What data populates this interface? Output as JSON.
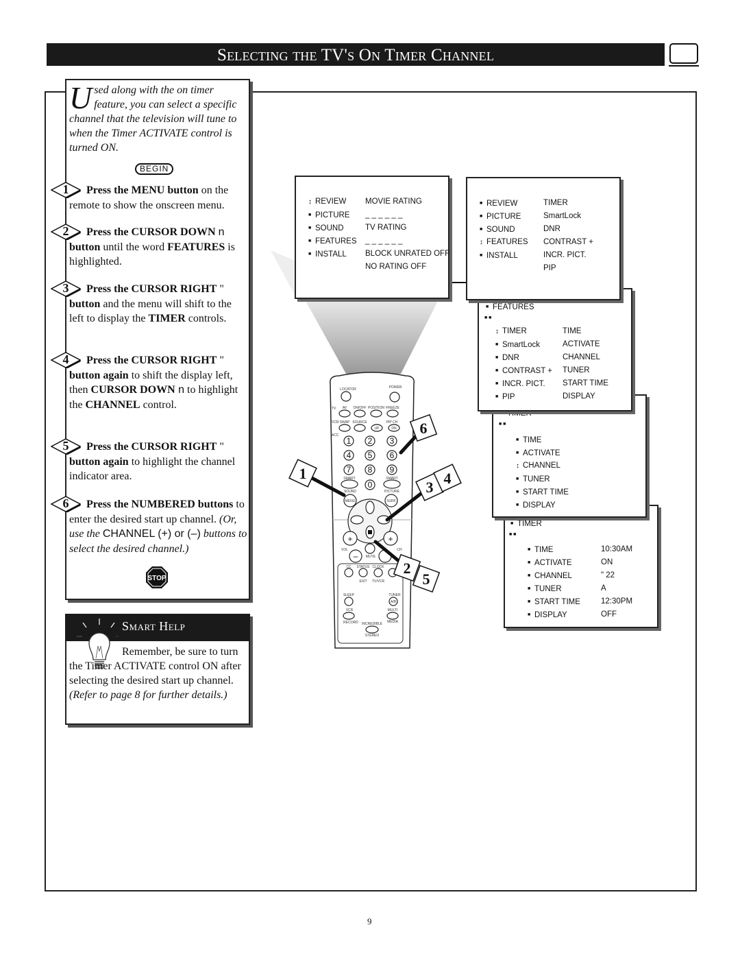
{
  "title": "Selecting the TV's On Timer Channel",
  "intro": {
    "dropcap": "U",
    "text": "sed along with the on timer feature, you can select a specific channel that the television will tune to when the Timer ACTIVATE control is turned ON."
  },
  "begin_label": "BEGIN",
  "steps": [
    {
      "number": "1",
      "segments": [
        {
          "t": "Press the MENU button",
          "s": "b"
        },
        {
          "t": " on the remote to show the onscreen menu.",
          "s": ""
        }
      ]
    },
    {
      "number": "2",
      "segments": [
        {
          "t": "Press the CURSOR DOWN ",
          "s": "b"
        },
        {
          "t": "n",
          "s": "sans"
        },
        {
          "t": " button",
          "s": "b"
        },
        {
          "t": " until the word ",
          "s": ""
        },
        {
          "t": "FEATURES",
          "s": "b"
        },
        {
          "t": " is highlighted.",
          "s": ""
        }
      ]
    },
    {
      "number": "3",
      "segments": [
        {
          "t": "Press the CURSOR RIGHT",
          "s": "b"
        },
        {
          "t": " \"      ",
          "s": ""
        },
        {
          "t": "button",
          "s": "b"
        },
        {
          "t": " and the menu will shift to the left to display the ",
          "s": ""
        },
        {
          "t": "TIMER",
          "s": "b"
        },
        {
          "t": " controls.",
          "s": ""
        }
      ]
    },
    {
      "number": "4",
      "segments": [
        {
          "t": "Press the CURSOR RIGHT",
          "s": "b"
        },
        {
          "t": " \"      ",
          "s": ""
        },
        {
          "t": "button again",
          "s": "b"
        },
        {
          "t": " to shift the display left, then ",
          "s": ""
        },
        {
          "t": "CURSOR DOWN",
          "s": "b"
        },
        {
          "t": " n",
          "s": "sans"
        },
        {
          "t": "  to highlight the ",
          "s": ""
        },
        {
          "t": "CHANNEL",
          "s": "b"
        },
        {
          "t": " control.",
          "s": ""
        }
      ]
    },
    {
      "number": "5",
      "segments": [
        {
          "t": "Press the CURSOR RIGHT",
          "s": "b"
        },
        {
          "t": " \"      ",
          "s": ""
        },
        {
          "t": "button again",
          "s": "b"
        },
        {
          "t": " to highlight the channel indicator area.",
          "s": ""
        }
      ]
    },
    {
      "number": "6",
      "segments": [
        {
          "t": "Press the NUMBERED buttons",
          "s": "b"
        },
        {
          "t": " to enter the desired start up channel. ",
          "s": ""
        },
        {
          "t": "(Or, use the ",
          "s": "i"
        },
        {
          "t": "CHANNEL (+) or (–)",
          "s": "sans"
        },
        {
          "t": " buttons to select the desired channel.)",
          "s": "i"
        }
      ]
    }
  ],
  "stop_label": "STOP",
  "smart_help": {
    "title": "Smart Help",
    "segments": [
      {
        "t": "Remember, be sure to turn the Timer ACTIVATE control ON after selecting the desired start up channel. ",
        "s": ""
      },
      {
        "t": "(Refer to page 8 for further details.)",
        "s": "i"
      }
    ]
  },
  "menus": [
    {
      "header": [],
      "rows": [
        {
          "left": "REVIEW",
          "right": "MOVIE RATING",
          "selected": true
        },
        {
          "left": "PICTURE",
          "right": "_ _ _ _ _ _"
        },
        {
          "left": "SOUND",
          "right": "TV RATING"
        },
        {
          "left": "FEATURES",
          "right": "_ _ _ _ _ _"
        },
        {
          "left": "INSTALL",
          "right": "BLOCK UNRATED  OFF"
        },
        {
          "left": "",
          "right": "NO RATING          OFF"
        }
      ]
    },
    {
      "header": [],
      "rows": [
        {
          "left": "REVIEW",
          "right": "TIMER"
        },
        {
          "left": "PICTURE",
          "right": "SmartLock"
        },
        {
          "left": "SOUND",
          "right": "DNR"
        },
        {
          "left": "FEATURES",
          "right": "CONTRAST +",
          "selected": true
        },
        {
          "left": "INSTALL",
          "right": "INCR. PICT."
        },
        {
          "left": "",
          "right": "PIP"
        }
      ]
    },
    {
      "header": [
        "FEATURES",
        "■ ■"
      ],
      "rows": [
        {
          "left": "TIMER",
          "right": "TIME",
          "selected": true
        },
        {
          "left": "SmartLock",
          "right": "ACTIVATE"
        },
        {
          "left": "DNR",
          "right": "CHANNEL"
        },
        {
          "left": "CONTRAST +",
          "right": "TUNER"
        },
        {
          "left": "INCR. PICT.",
          "right": "START TIME"
        },
        {
          "left": "PIP",
          "right": "DISPLAY"
        }
      ]
    },
    {
      "header": [
        "TIMER",
        "■ ■"
      ],
      "rows": [
        {
          "left": "TIME",
          "right": ""
        },
        {
          "left": "ACTIVATE",
          "right": ""
        },
        {
          "left": "CHANNEL",
          "right": "",
          "selected": true
        },
        {
          "left": "TUNER",
          "right": ""
        },
        {
          "left": "START TIME",
          "right": ""
        },
        {
          "left": "DISPLAY",
          "right": ""
        }
      ]
    },
    {
      "header": [
        "TIMER",
        "■ ■"
      ],
      "rows": [
        {
          "left": "TIME",
          "right": "10:30AM"
        },
        {
          "left": "ACTIVATE",
          "right": "ON"
        },
        {
          "left": "CHANNEL",
          "right": "\" 22"
        },
        {
          "left": "TUNER",
          "right": "A"
        },
        {
          "left": "START TIME",
          "right": "12:30PM"
        },
        {
          "left": "DISPLAY",
          "right": "OFF"
        }
      ]
    }
  ],
  "remote": {
    "labels": {
      "locator": "LOCATOR",
      "power": "POWER",
      "tv": "TV",
      "av": "AV",
      "onoff": "ON/OFF",
      "position": "POSITION",
      "freeze": "FREEZE",
      "vcr": "VCR",
      "swap": "SWAP",
      "source": "SOURCE",
      "pipch": "PIP CH",
      "up": "UP",
      "dn": "DN",
      "acc": "ACC",
      "smart1": "SMART",
      "sound": "SOUND",
      "smart2": "SMART",
      "picture": "PICTURE",
      "menu": "MENU",
      "surf": "SURF",
      "vol": "VOL",
      "ch": "CH",
      "mute": "MUTE",
      "cc": "CC",
      "status": "STATUS",
      "clock": "CLOCK",
      "exit": "EXIT",
      "tvvcr": "TV/VCR",
      "sleep": "SLEEP",
      "tuner": "TUNER",
      "ab": "A/B",
      "vcr2": "VCR",
      "record": "RECORD",
      "multi": "MULTI",
      "media": "MEDIA",
      "incredible": "INCREDIBLE",
      "stereo": "STEREO",
      "plus": "+",
      "minus": "–"
    },
    "digits": [
      "1",
      "2",
      "3",
      "4",
      "5",
      "6",
      "7",
      "8",
      "9",
      "0"
    ]
  },
  "step_tags": [
    "6",
    "1",
    "3",
    "4",
    "2",
    "5"
  ],
  "page_number": "9"
}
